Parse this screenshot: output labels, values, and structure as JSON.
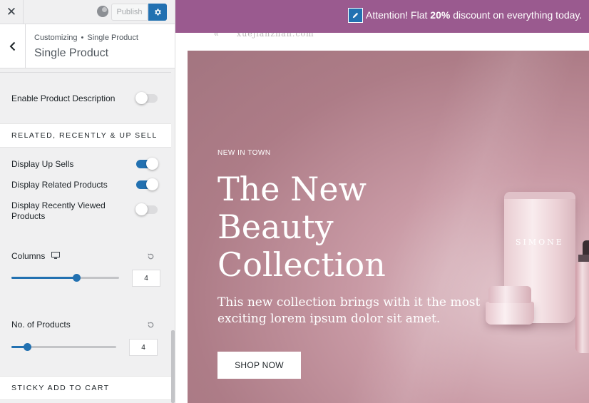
{
  "topbar": {
    "close_icon": "close-icon",
    "publish_label": "Publish",
    "settings_icon": "gear-icon"
  },
  "header": {
    "breadcrumb_root": "Customizing",
    "breadcrumb_separator": "•",
    "breadcrumb_current": "Single Product",
    "title": "Single Product"
  },
  "settings": {
    "enable_description": {
      "label": "Enable Product Description",
      "enabled": false
    },
    "related_section_title": "RELATED, RECENTLY & UP SELL",
    "up_sells": {
      "label": "Display Up Sells",
      "enabled": true
    },
    "related_products": {
      "label": "Display Related Products",
      "enabled": true
    },
    "recently_viewed": {
      "label": "Display Recently Viewed Products",
      "enabled": false
    },
    "columns": {
      "label": "Columns",
      "value": "4",
      "slider_fraction": 0.6
    },
    "no_of_products": {
      "label": "No. of Products",
      "value": "4",
      "slider_fraction": 0.15
    },
    "sticky_section_title": "STICKY ADD TO CART"
  },
  "preview": {
    "announcement": {
      "prefix": "Attention! Flat ",
      "highlight": "20%",
      "suffix": " discount on everything today."
    },
    "logo_text": "xuejianzhan.com",
    "hero": {
      "eyebrow": "NEW IN TOWN",
      "headline_line1": "The New",
      "headline_line2": "Beauty",
      "headline_line3": "Collection",
      "subheading": "This new collection brings with it the most exciting lorem ipsum dolor sit amet.",
      "cta_label": "SHOP NOW",
      "product_label": "SIMONE"
    }
  },
  "colors": {
    "accent": "#2271b1",
    "announcement_bg": "#9a5a8f",
    "hero_bg": "#ad7c87"
  }
}
